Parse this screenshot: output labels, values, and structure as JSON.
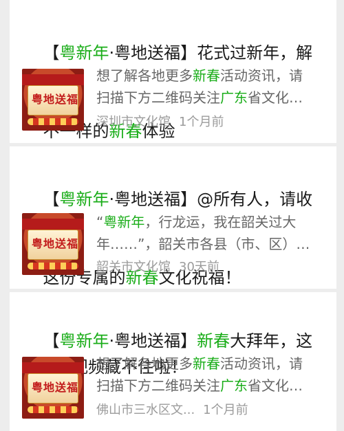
{
  "items": [
    {
      "title_parts": [
        "【",
        "粤新年",
        "·粤地送福】花式过新年，解锁",
        "不一样的",
        "新春",
        "体验"
      ],
      "snippet_lines": [
        [
          "想了解各地更多",
          "新春",
          "活动资讯，请"
        ],
        [
          "扫描下方二维码关注",
          "广东",
          "省文化…"
        ]
      ],
      "source": "深圳市文化馆",
      "time": "1个月前"
    },
    {
      "title_parts": [
        "【",
        "粤新年",
        "·粤地送福】@所有人，请收下",
        "这份专属的",
        "新春",
        "文化祝福！"
      ],
      "snippet_lines": [
        [
          "“",
          "粤新年",
          "，行龙运，我在韶关过大"
        ],
        [
          "年……”，韶关市各县（市、区）…",
          "",
          ""
        ]
      ],
      "source": "韶关市文化馆",
      "time": "30天前"
    },
    {
      "title_parts": [
        "【",
        "粤新年",
        "·粤地送福】",
        "新春",
        "大拜年，这波祝福视频藏不住啦！",
        ""
      ],
      "snippet_lines": [
        [
          "想了解各地更多",
          "新春",
          "活动资讯，请"
        ],
        [
          "扫描下方二维码关注",
          "广东",
          "省文化…"
        ]
      ],
      "source": "佛山市三水区文...",
      "time": "1个月前"
    }
  ],
  "thumbnail": {
    "logo_text": "粤地送福"
  },
  "colors": {
    "highlight": "#1aad19",
    "text": "#1a1a1a",
    "muted": "#9b9b9b",
    "snippet": "#666666",
    "background": "#ededed",
    "card": "#ffffff"
  }
}
